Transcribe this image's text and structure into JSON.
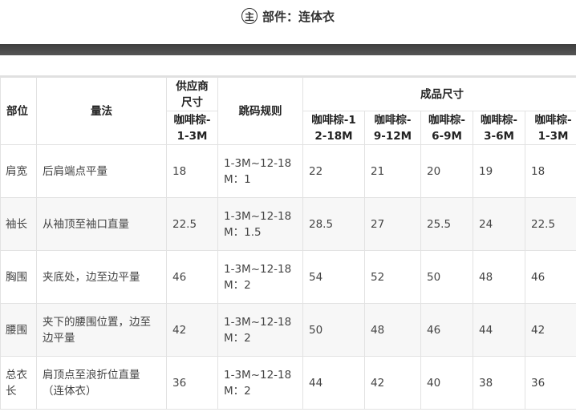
{
  "header": {
    "badge": "主",
    "title": "部件：连体衣"
  },
  "table": {
    "col_part": "部位",
    "col_method": "量法",
    "col_supplier": "供应商尺寸",
    "col_rule": "跳码规则",
    "col_finished": "成品尺寸",
    "supplier_size": "咖啡棕-1-3M",
    "finished_sizes": [
      "咖啡棕-12-18M",
      "咖啡棕-9-12M",
      "咖啡棕-6-9M",
      "咖啡棕-3-6M",
      "咖啡棕-1-3M"
    ],
    "rows": [
      {
        "part": "肩宽",
        "method": "后肩端点平量",
        "supplier": "18",
        "rule": "1-3M~12-18M：1",
        "values": [
          "22",
          "21",
          "20",
          "19",
          "18"
        ]
      },
      {
        "part": "袖长",
        "method": "从袖顶至袖口直量",
        "supplier": "22.5",
        "rule": "1-3M~12-18M：1.5",
        "values": [
          "28.5",
          "27",
          "25.5",
          "24",
          "22.5"
        ]
      },
      {
        "part": "胸围",
        "method": "夹底处，边至边平量",
        "supplier": "46",
        "rule": "1-3M~12-18M：2",
        "values": [
          "54",
          "52",
          "50",
          "48",
          "46"
        ]
      },
      {
        "part": "腰围",
        "method": "夹下的腰围位置，边至边平量",
        "supplier": "42",
        "rule": "1-3M~12-18M：2",
        "values": [
          "50",
          "48",
          "46",
          "44",
          "42"
        ]
      },
      {
        "part": "总衣长",
        "method": "肩顶点至浪折位直量（连体衣）",
        "supplier": "36",
        "rule": "1-3M~12-18M：2",
        "values": [
          "44",
          "42",
          "40",
          "38",
          "36"
        ]
      }
    ]
  }
}
